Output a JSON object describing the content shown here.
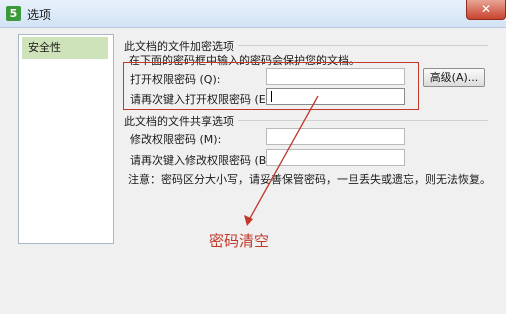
{
  "window": {
    "title": "选项",
    "app_icon_text": "5",
    "close_label": "✕"
  },
  "sidebar": {
    "items": [
      {
        "label": "安全性"
      }
    ]
  },
  "encryption": {
    "group_title": "此文档的文件加密选项",
    "description": "在下面的密码框中输入的密码会保护您的文档。",
    "open_password_label": "打开权限密码 (Q):",
    "open_password_value": "",
    "confirm_open_password_label": "请再次键入打开权限密码 (E):",
    "confirm_open_password_value": "",
    "advanced_button": "高级(A)..."
  },
  "sharing": {
    "group_title": "此文档的文件共享选项",
    "modify_password_label": "修改权限密码 (M):",
    "modify_password_value": "",
    "confirm_modify_password_label": "请再次键入修改权限密码 (B):",
    "confirm_modify_password_value": ""
  },
  "note": "注意：密码区分大小写，请妥善保管密码，一旦丢失或遗忘，则无法恢复。",
  "annotation": {
    "text": "密码清空",
    "color": "#c0392b"
  }
}
